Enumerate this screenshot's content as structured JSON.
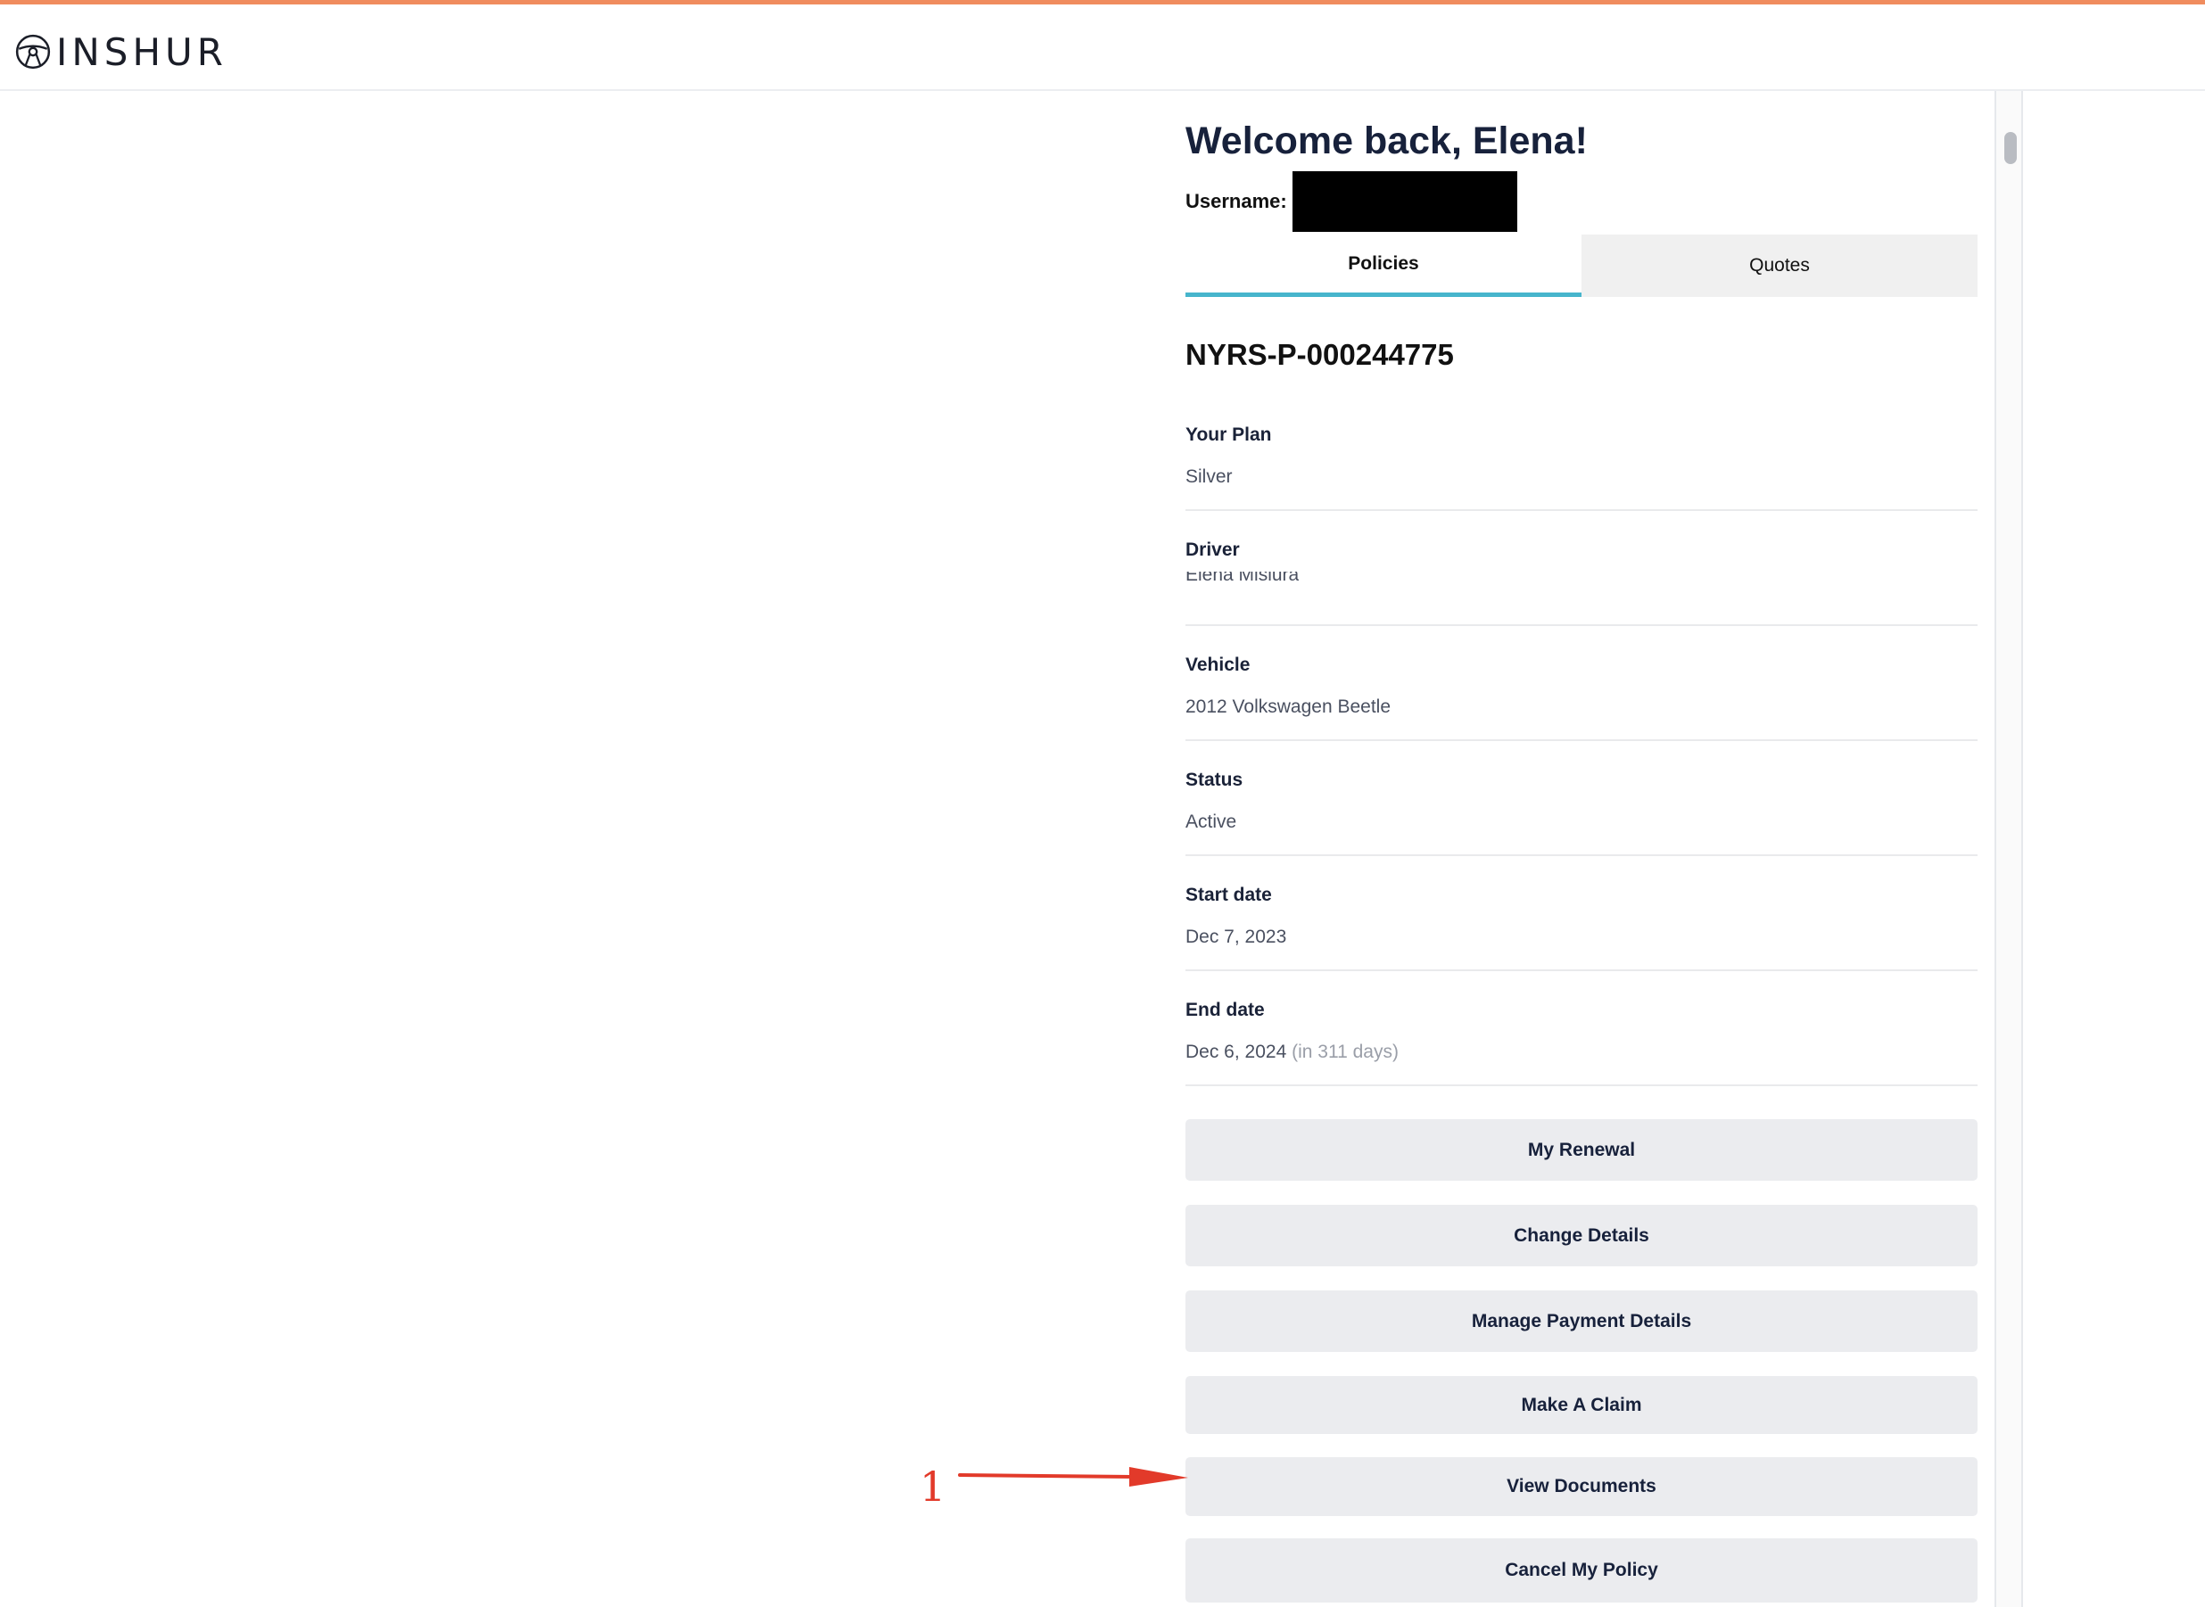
{
  "app": {
    "brand": "INSHUR",
    "colors": {
      "accent_top": "#f08c5e",
      "tab_underline": "#47b5cc",
      "annotation": "#e23a2a"
    }
  },
  "welcome": {
    "title": "Welcome back, Elena!"
  },
  "username": {
    "label": "Username:"
  },
  "tabs": [
    {
      "label": "Policies",
      "active": true
    },
    {
      "label": "Quotes",
      "active": false
    }
  ],
  "policy": {
    "id": "NYRS-P-000244775",
    "details": [
      {
        "label": "Your Plan",
        "value": "Silver"
      },
      {
        "label": "Driver",
        "value": "Elena Misiura"
      },
      {
        "label": "Vehicle",
        "value": "2012 Volkswagen Beetle"
      },
      {
        "label": "Status",
        "value": "Active"
      },
      {
        "label": "Start date",
        "value": "Dec 7, 2023"
      },
      {
        "label": "End date",
        "value": "Dec 6, 2024",
        "note": "(in 311 days)"
      }
    ]
  },
  "actions": {
    "my_renewal": "My Renewal",
    "change_details": "Change Details",
    "manage_payment": "Manage Payment Details",
    "make_claim": "Make A Claim",
    "view_documents": "View Documents",
    "cancel_policy": "Cancel My Policy"
  },
  "annotation": {
    "number": "1"
  },
  "icons": {
    "logo": "steering-wheel-icon"
  }
}
